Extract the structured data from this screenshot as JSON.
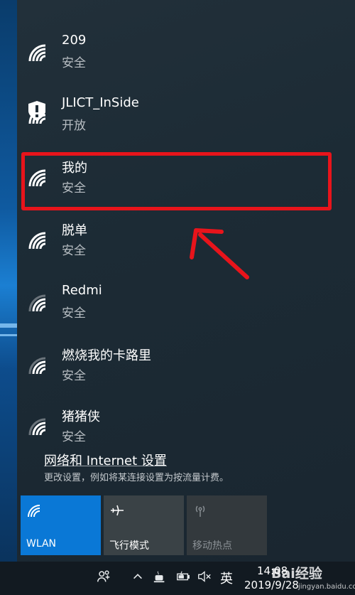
{
  "networks": [
    {
      "name": "209",
      "status": "安全",
      "signal": "full",
      "secured": true
    },
    {
      "name": "JLICT_InSide",
      "status": "开放",
      "signal": "full",
      "secured": false
    },
    {
      "name": "我的",
      "status": "安全",
      "signal": "full",
      "secured": true
    },
    {
      "name": "脱单",
      "status": "安全",
      "signal": "full",
      "secured": true
    },
    {
      "name": "Redmi",
      "status": "安全",
      "signal": "medium",
      "secured": true
    },
    {
      "name": "燃烧我的卡路里",
      "status": "安全",
      "signal": "medium",
      "secured": true
    },
    {
      "name": "猪猪侠",
      "status": "安全",
      "signal": "medium",
      "secured": true
    }
  ],
  "settings": {
    "link_label": "网络和 Internet 设置",
    "description": "更改设置，例如将某连接设置为按流量计费。"
  },
  "tiles": [
    {
      "label": "WLAN",
      "icon": "wifi-icon",
      "state": "on"
    },
    {
      "label": "飞行模式",
      "icon": "airplane-icon",
      "state": "off"
    },
    {
      "label": "移动热点",
      "icon": "hotspot-icon",
      "state": "disabled"
    }
  ],
  "taskbar": {
    "ime": "英",
    "time": "14:08",
    "date": "2019/9/28",
    "icons": [
      "people-icon",
      "chevron-up-icon",
      "coffee-icon",
      "battery-icon",
      "volume-muted-icon"
    ]
  },
  "watermark": {
    "main": "Bai经验",
    "sub": "jingyan.baidu.com"
  },
  "colors": {
    "highlight": "#e8141b",
    "accent": "#0a78d6",
    "flyout_bg": "#1f2d37"
  }
}
